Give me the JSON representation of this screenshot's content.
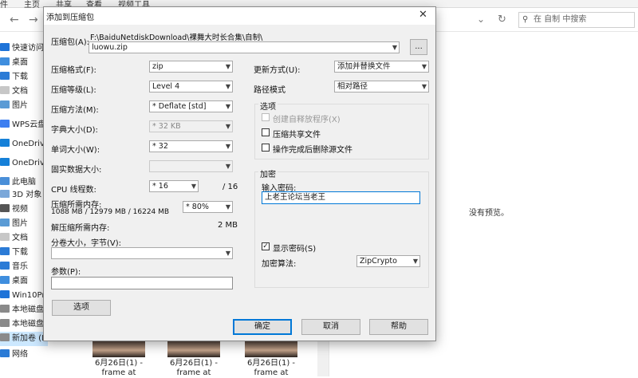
{
  "explorer": {
    "ribbon_tabs": [
      "件",
      "主页",
      "共享",
      "查看",
      "视频工具"
    ],
    "search_placeholder": "在 自制 中搜索",
    "nav_items": [
      "快速访问",
      "桌面",
      "下载",
      "文档",
      "图片",
      "WPS云盘",
      "OneDrive",
      "OneDrive",
      "此电脑",
      "3D 对象",
      "视频",
      "图片",
      "文档",
      "下载",
      "音乐",
      "桌面",
      "Win10Pr",
      "本地磁盘",
      "本地磁盘",
      "新加卷 (I",
      "网络"
    ],
    "no_preview": "没有预览。",
    "thumbnails": [
      {
        "caption1": "6月26日(1) -",
        "caption2": "frame at"
      },
      {
        "caption1": "6月26日(1) -",
        "caption2": "frame at"
      },
      {
        "caption1": "6月26日(1) -",
        "caption2": "frame at"
      }
    ]
  },
  "dialog": {
    "title": "添加到压缩包",
    "close_glyph": "✕",
    "archive_label": "压缩包(A):",
    "archive_path": "F:\\BaiduNetdiskDownload\\裸舞大时长合集\\自制\\",
    "archive_name": "luowu.zip",
    "browse_label": "...",
    "format_label": "压缩格式(F):",
    "format_value": "zip",
    "level_label": "压缩等级(L):",
    "level_value": "Level 4",
    "method_label": "压缩方法(M):",
    "method_value": "* Deflate [std]",
    "dict_label": "字典大小(D):",
    "dict_value": "* 32 KB",
    "word_label": "单词大小(W):",
    "word_value": "* 32",
    "solid_label": "固实数据大小:",
    "solid_value": "",
    "cpu_label": "CPU 线程数:",
    "cpu_value": "* 16",
    "cpu_total": "/ 16",
    "mem_label": "压缩所需内存:",
    "mem_detail": "1088 MB / 12979 MB / 16224 MB",
    "mem_value": "* 80%",
    "decomp_label": "解压缩所需内存:",
    "decomp_value": "2 MB",
    "split_label": "分卷大小，字节(V):",
    "split_value": "",
    "params_label": "参数(P):",
    "params_value": "",
    "options_button": "选项",
    "update_label": "更新方式(U):",
    "update_value": "添加并替换文件",
    "path_label": "路径模式",
    "path_value": "相对路径",
    "options_group": "选项",
    "opt_sfx": "创建自释放程序(X)",
    "opt_shared": "压缩共享文件",
    "opt_delete": "操作完成后删除源文件",
    "encrypt_group": "加密",
    "password_label": "输入密码:",
    "password_value": "上老王论坛当老王",
    "show_password": "显示密码(S)",
    "show_password_mark": "✓",
    "enc_method_label": "加密算法:",
    "enc_method_value": "ZipCrypto",
    "ok_button": "确定",
    "cancel_button": "取消",
    "help_button": "帮助"
  },
  "colors": {
    "accent": "#0078d7",
    "dialog_bg": "#f0f0f0"
  }
}
